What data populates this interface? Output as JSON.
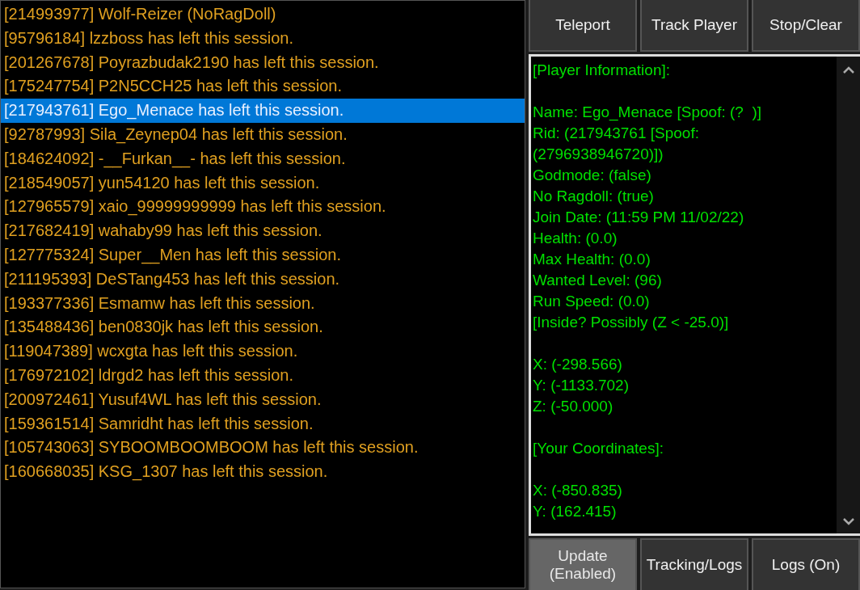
{
  "session_log": [
    {
      "text": "[214993977] Wolf-Reizer (NoRagDoll)",
      "selected": false
    },
    {
      "text": "[95796184] lzzboss has left this session.",
      "selected": false
    },
    {
      "text": "[201267678] Poyrazbudak2190 has left this session.",
      "selected": false
    },
    {
      "text": "[175247754] P2N5CCH25 has left this session.",
      "selected": false
    },
    {
      "text": "[217943761] Ego_Menace has left this session.",
      "selected": true
    },
    {
      "text": "[92787993] Sila_Zeynep04 has left this session.",
      "selected": false
    },
    {
      "text": "[184624092] -__Furkan__- has left this session.",
      "selected": false
    },
    {
      "text": "[218549057] yun54120 has left this session.",
      "selected": false
    },
    {
      "text": "[127965579] xaio_99999999999 has left this session.",
      "selected": false
    },
    {
      "text": "[217682419] wahaby99 has left this session.",
      "selected": false
    },
    {
      "text": "[127775324] Super__Men has left this session.",
      "selected": false
    },
    {
      "text": "[211195393] DeSTang453 has left this session.",
      "selected": false
    },
    {
      "text": "[193377336] Esmamw has left this session.",
      "selected": false
    },
    {
      "text": "[135488436] ben0830jk has left this session.",
      "selected": false
    },
    {
      "text": "[119047389] wcxgta has left this session.",
      "selected": false
    },
    {
      "text": "[176972102] ldrgd2 has left this session.",
      "selected": false
    },
    {
      "text": "[200972461] Yusuf4WL has left this session.",
      "selected": false
    },
    {
      "text": "[159361514] Samridht has left this session.",
      "selected": false
    },
    {
      "text": "[105743063] SYBOOMBOOMBOOM has left this session.",
      "selected": false
    },
    {
      "text": "[160668035] KSG_1307 has left this session.",
      "selected": false
    }
  ],
  "top_buttons": [
    {
      "label": "Teleport",
      "highlighted": false
    },
    {
      "label": "Track Player",
      "highlighted": false
    },
    {
      "label": "Stop/Clear",
      "highlighted": false
    }
  ],
  "info_sections": [
    {
      "lines": [
        "[Player Information]:"
      ]
    },
    {
      "lines": [
        "Name: Ego_Menace [Spoof: (?  )]",
        "Rid: (217943761 [Spoof: (2796938946720)])",
        "Godmode: (false)",
        "No Ragdoll: (true)",
        "Join Date: (11:59 PM 11/02/22)",
        "Health: (0.0)",
        "Max Health: (0.0)",
        "Wanted Level: (96)",
        "Run Speed: (0.0)",
        "[Inside? Possibly (Z < -25.0)]"
      ]
    },
    {
      "lines": [
        "X: (-298.566)",
        "Y: (-1133.702)",
        "Z: (-50.000)"
      ]
    },
    {
      "lines": [
        "[Your Coordinates]:"
      ]
    },
    {
      "lines": [
        "X: (-850.835)",
        "Y: (162.415)"
      ]
    }
  ],
  "bottom_buttons": [
    {
      "label": "Update (Enabled)",
      "highlighted": true
    },
    {
      "label": "Tracking/Logs",
      "highlighted": false
    },
    {
      "label": "Logs (On)",
      "highlighted": false
    }
  ]
}
